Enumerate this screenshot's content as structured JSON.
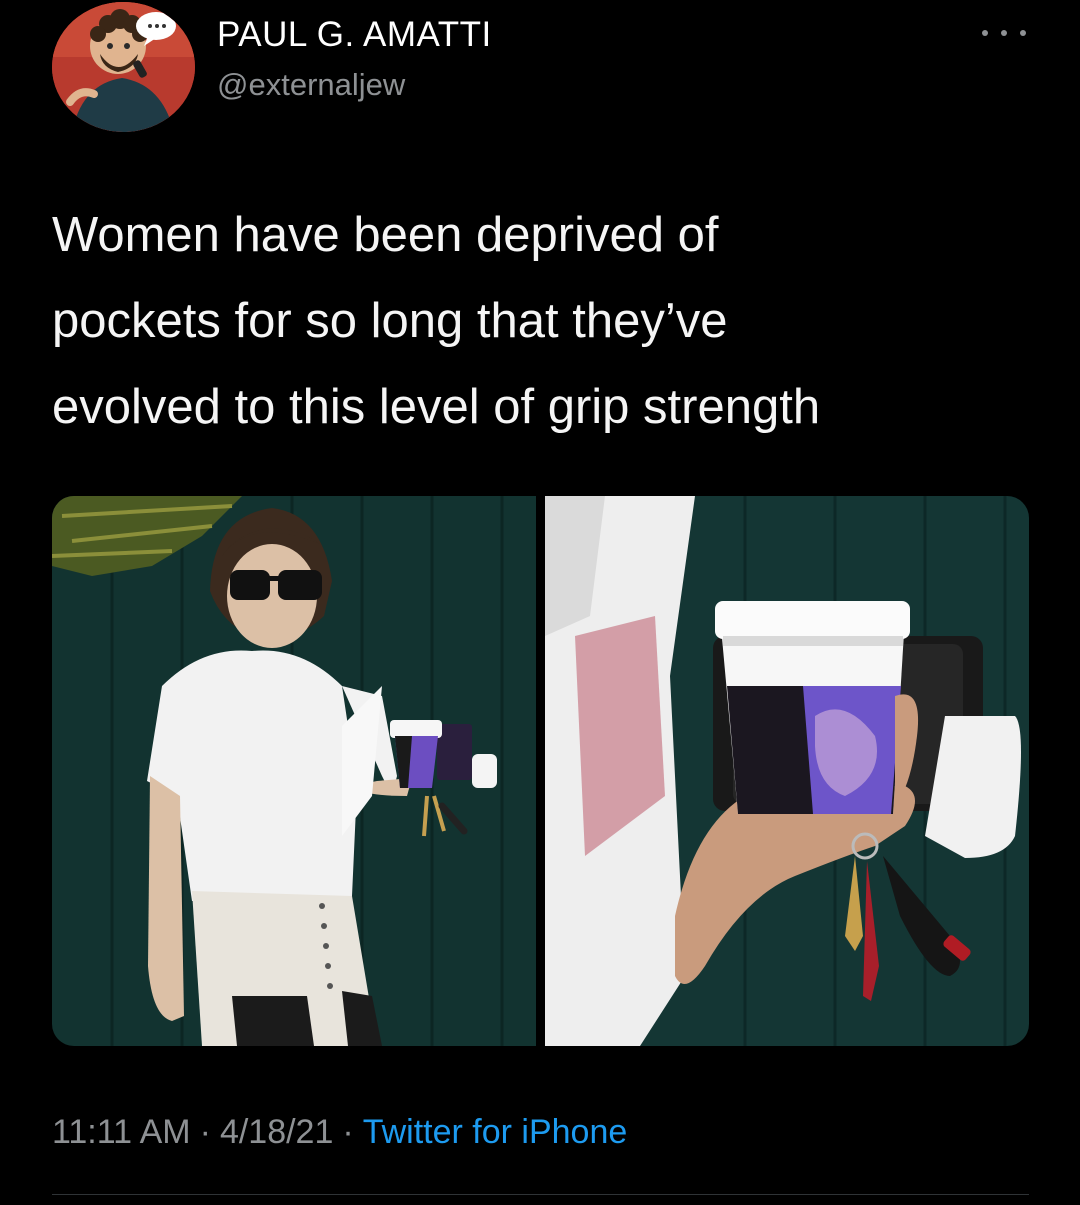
{
  "author": {
    "display_name": "PAUL G. AMATTI",
    "handle": "@externaljew"
  },
  "tweet": {
    "lines": [
      "Women have been deprived of",
      "pockets for so long that they’ve",
      "evolved to this level of grip strength"
    ]
  },
  "media": {
    "photo_count": 2
  },
  "meta": {
    "time": "11:11 AM",
    "separator": "·",
    "date": "4/18/21",
    "source": "Twitter for iPhone"
  },
  "colors": {
    "background": "#000000",
    "text": "#ffffff",
    "secondary_text": "#8e9194",
    "link": "#1d9bf0",
    "divider": "#2f3336"
  },
  "icons": {
    "more": "more-horizontal-icon"
  }
}
